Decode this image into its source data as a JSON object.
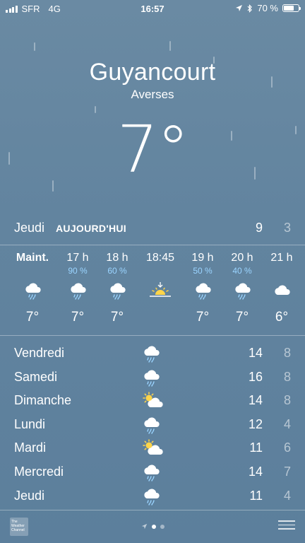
{
  "status_bar": {
    "carrier": "SFR",
    "network": "4G",
    "time": "16:57",
    "battery": "70 %",
    "battery_level": 0.7
  },
  "location": {
    "city": "Guyancourt",
    "condition": "Averses",
    "temperature": "7°"
  },
  "today": {
    "day": "Jeudi",
    "label": "AUJOURD'HUI",
    "high": "9",
    "low": "3"
  },
  "hourly": [
    {
      "time": "Maint.",
      "pct": "",
      "icon": "rain-cloud-icon",
      "temp": "7°"
    },
    {
      "time": "17 h",
      "pct": "90 %",
      "icon": "rain-cloud-icon",
      "temp": "7°"
    },
    {
      "time": "18 h",
      "pct": "60 %",
      "icon": "rain-cloud-icon",
      "temp": "7°"
    },
    {
      "time": "18:45",
      "pct": "",
      "icon": "sunset-icon",
      "temp": ""
    },
    {
      "time": "19 h",
      "pct": "50 %",
      "icon": "rain-cloud-icon",
      "temp": "7°"
    },
    {
      "time": "20 h",
      "pct": "40 %",
      "icon": "rain-cloud-icon",
      "temp": "7°"
    },
    {
      "time": "21 h",
      "pct": "",
      "icon": "cloud-icon",
      "temp": "6°"
    }
  ],
  "daily": [
    {
      "day": "Vendredi",
      "icon": "rain-cloud-icon",
      "high": "14",
      "low": "8"
    },
    {
      "day": "Samedi",
      "icon": "rain-cloud-icon",
      "high": "16",
      "low": "8"
    },
    {
      "day": "Dimanche",
      "icon": "partly-sunny-icon",
      "high": "14",
      "low": "8"
    },
    {
      "day": "Lundi",
      "icon": "rain-cloud-icon",
      "high": "12",
      "low": "4"
    },
    {
      "day": "Mardi",
      "icon": "partly-sunny-icon",
      "high": "11",
      "low": "6"
    },
    {
      "day": "Mercredi",
      "icon": "rain-cloud-icon",
      "high": "14",
      "low": "7"
    },
    {
      "day": "Jeudi",
      "icon": "rain-cloud-icon",
      "high": "11",
      "low": "4"
    }
  ],
  "bottom": {
    "weather_channel": "The Weather Channel",
    "pages": 2,
    "active_page": 1
  },
  "colors": {
    "background": "#62849f",
    "precip": "#9ad4ff"
  }
}
